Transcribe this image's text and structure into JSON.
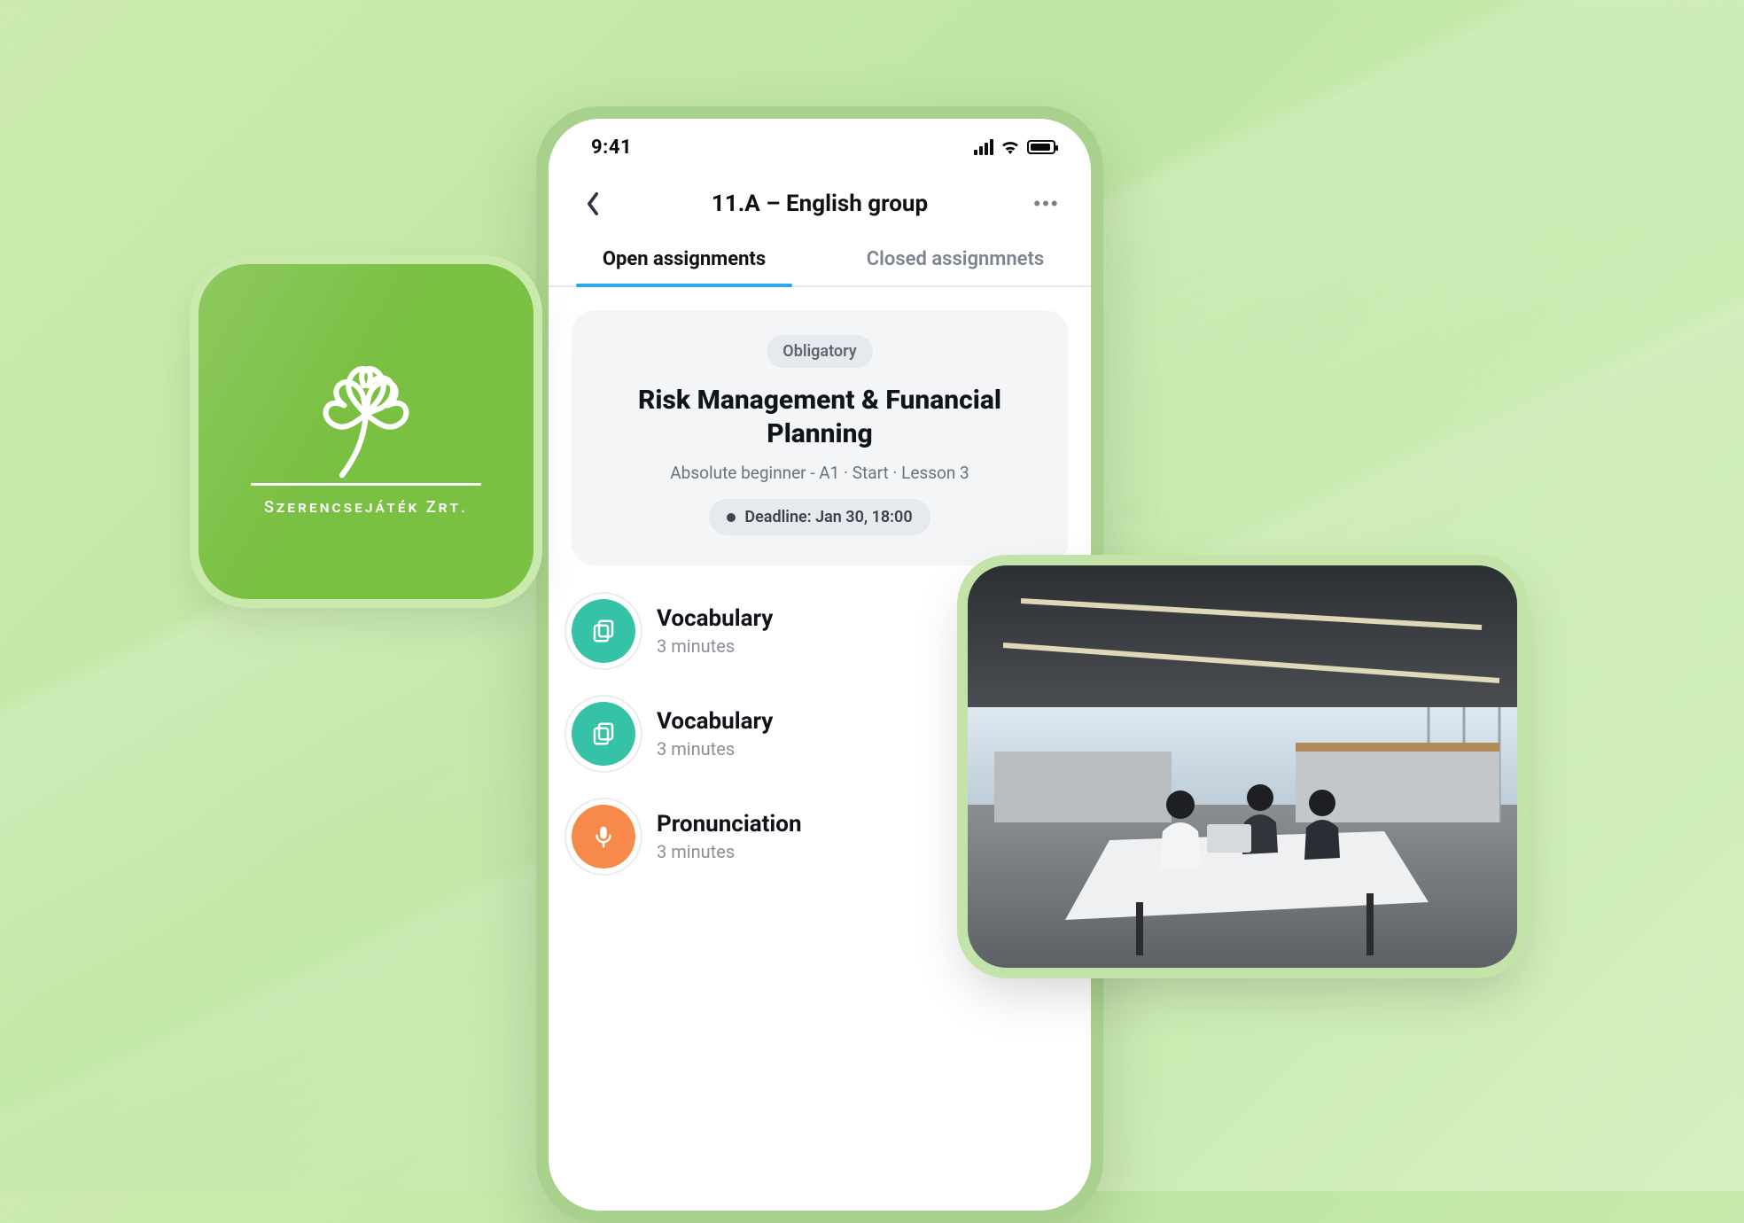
{
  "statusbar": {
    "time": "9:41"
  },
  "nav": {
    "title": "11.A –  English group"
  },
  "tabs": {
    "open": "Open assignments",
    "closed": "Closed assignmnets"
  },
  "card": {
    "tag": "Obligatory",
    "title": "Risk Management & Funancial Planning",
    "subtitle": "Absolute beginner - A1 · Start  · Lesson 3",
    "deadline": "Deadline: Jan 30, 18:00"
  },
  "tasks": [
    {
      "icon": "copy",
      "color": "teal",
      "title": "Vocabulary",
      "duration": "3 minutes"
    },
    {
      "icon": "copy",
      "color": "teal",
      "title": "Vocabulary",
      "duration": "3 minutes"
    },
    {
      "icon": "mic",
      "color": "orange",
      "title": "Pronunciation",
      "duration": "3 minutes"
    }
  ],
  "logo": {
    "brand": "Szerencsejáték Zrt."
  }
}
